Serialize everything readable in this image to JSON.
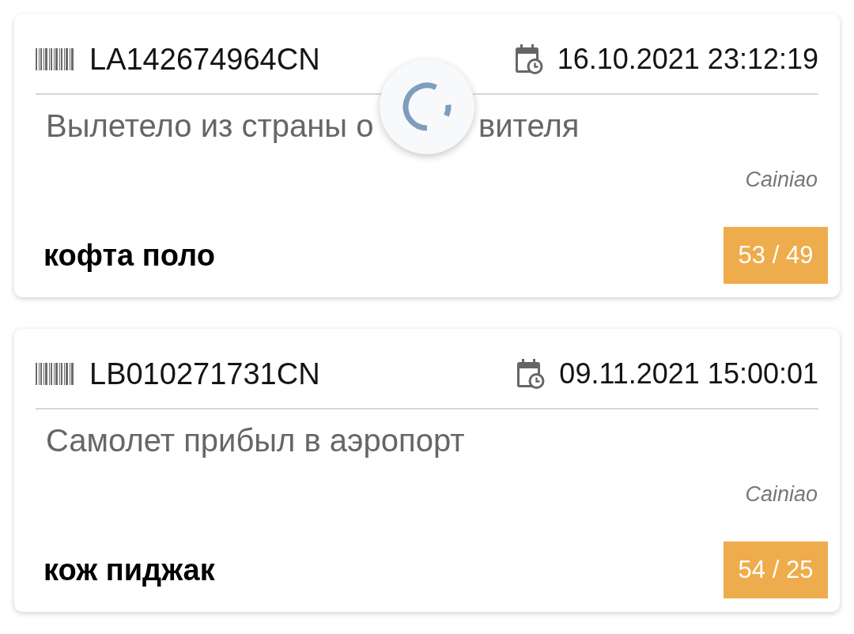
{
  "loading": true,
  "shipments": [
    {
      "tracking_number": "LA142674964CN",
      "date": "16.10.2021 23:12:19",
      "status": [
        "Вылетело из страны о",
        "вителя"
      ],
      "carrier": "Cainiao",
      "item_name": "кофта поло",
      "counter": "53 / 49"
    },
    {
      "tracking_number": "LB010271731CN",
      "date": "09.11.2021 15:00:01",
      "status": [
        "Самолет прибыл в аэропорт"
      ],
      "carrier": "Cainiao",
      "item_name": "кож пиджак",
      "counter": "54 / 25"
    }
  ]
}
